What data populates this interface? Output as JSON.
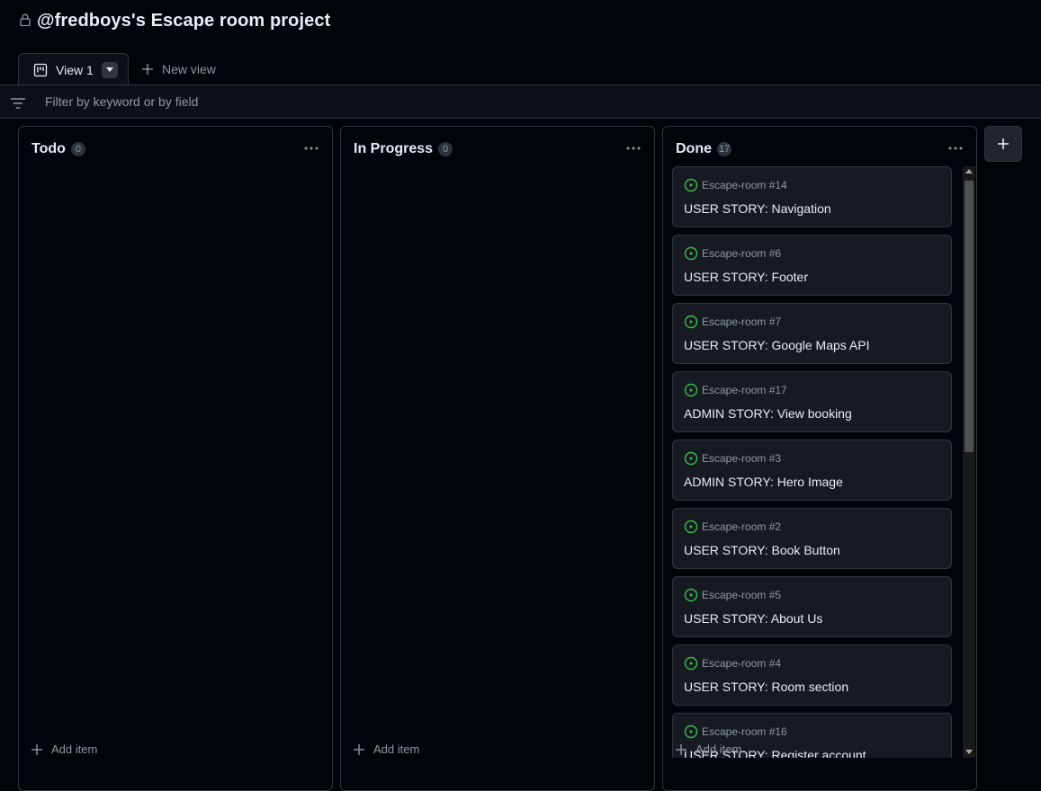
{
  "project": {
    "title": "@fredboys's Escape room project"
  },
  "tabs": {
    "active_label": "View 1",
    "new_view_label": "New view"
  },
  "filter": {
    "placeholder": "Filter by keyword or by field",
    "value": ""
  },
  "columns": [
    {
      "name": "Todo",
      "count": "0",
      "add_label": "Add item"
    },
    {
      "name": "In Progress",
      "count": "0",
      "add_label": "Add item"
    },
    {
      "name": "Done",
      "count": "17",
      "add_label": "Add item"
    }
  ],
  "done_cards": [
    {
      "repo": "Escape-room #14",
      "title": "USER STORY: Navigation"
    },
    {
      "repo": "Escape-room #6",
      "title": "USER STORY: Footer"
    },
    {
      "repo": "Escape-room #7",
      "title": "USER STORY: Google Maps API"
    },
    {
      "repo": "Escape-room #17",
      "title": "ADMIN STORY: View booking"
    },
    {
      "repo": "Escape-room #3",
      "title": "ADMIN STORY: Hero Image"
    },
    {
      "repo": "Escape-room #2",
      "title": "USER STORY: Book Button"
    },
    {
      "repo": "Escape-room #5",
      "title": "USER STORY: About Us"
    },
    {
      "repo": "Escape-room #4",
      "title": "USER STORY: Room section"
    },
    {
      "repo": "Escape-room #16",
      "title": "USER STORY: Register account"
    }
  ],
  "icons": {
    "lock": "lock-icon",
    "board": "project-board-icon",
    "dropdown": "triangle-down-icon",
    "plus": "plus-icon",
    "filter": "filter-lines-icon",
    "more": "kebab-horizontal-icon",
    "issue_closed": "issue-circle-icon"
  },
  "colors": {
    "background": "#010409",
    "surface": "#0d1117",
    "card": "#161b22",
    "border": "#30363d",
    "text": "#e6edf3",
    "muted": "#9198a1",
    "issue_green": "#3fb950"
  }
}
